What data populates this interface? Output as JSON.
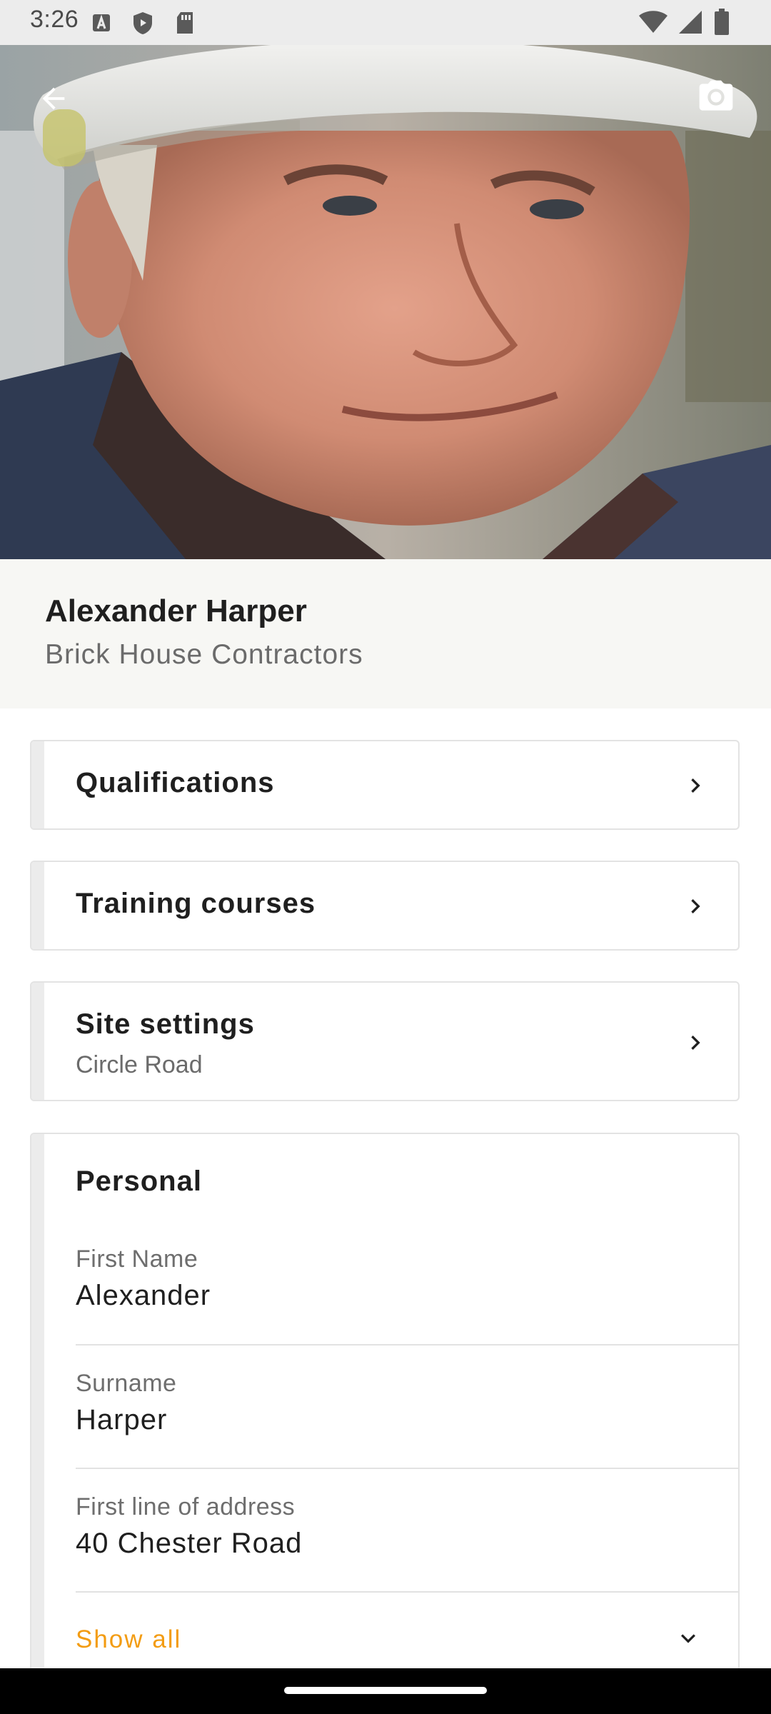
{
  "status_bar": {
    "time": "3:26",
    "left_icons": [
      "a-icon",
      "shield-play-icon",
      "sd-card-icon"
    ],
    "right_icons": [
      "wifi-icon",
      "cell-signal-icon",
      "battery-icon"
    ]
  },
  "hero": {
    "back_icon": "arrow-back-icon",
    "camera_icon": "camera-icon"
  },
  "profile": {
    "name": "Alexander Harper",
    "company": "Brick House Contractors"
  },
  "menu": {
    "qualifications": "Qualifications",
    "training": "Training courses",
    "site_settings": {
      "title": "Site settings",
      "subtitle": "Circle Road"
    }
  },
  "personal": {
    "heading": "Personal",
    "fields": [
      {
        "label": "First Name",
        "value": "Alexander"
      },
      {
        "label": "Surname",
        "value": "Harper"
      },
      {
        "label": "First line of address",
        "value": "40 Chester Road"
      }
    ],
    "show_all": "Show all"
  },
  "colors": {
    "accent": "#f39c12",
    "header_bg": "#f7f7f4",
    "card_border": "#e3e3e3"
  }
}
